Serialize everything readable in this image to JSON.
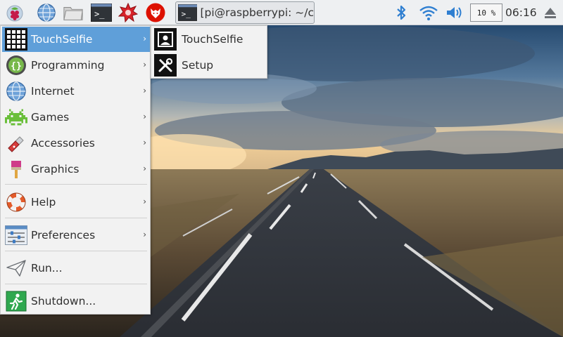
{
  "panel": {
    "launchers": [
      {
        "name": "raspberry-menu-icon"
      },
      {
        "name": "web-browser-icon"
      },
      {
        "name": "file-manager-icon"
      },
      {
        "name": "terminal-icon"
      },
      {
        "name": "mathematica-icon"
      },
      {
        "name": "wolfram-icon"
      }
    ],
    "task": {
      "label": "[pi@raspberrypi: ~/c..."
    },
    "tray": {
      "bluetooth_icon": "bluetooth-icon",
      "wifi_icon": "wifi-icon",
      "volume_icon": "volume-icon",
      "cpu_usage": "10 %",
      "clock": "06:16",
      "eject_icon": "eject-icon"
    }
  },
  "menu": {
    "items": [
      {
        "label": "TouchSelfie",
        "icon": "touchselfie-grid-icon",
        "submenu": true,
        "active": true
      },
      {
        "label": "Programming",
        "icon": "programming-braces-icon",
        "submenu": true
      },
      {
        "label": "Internet",
        "icon": "internet-globe-icon",
        "submenu": true
      },
      {
        "label": "Games",
        "icon": "games-invader-icon",
        "submenu": true
      },
      {
        "label": "Accessories",
        "icon": "accessories-knife-icon",
        "submenu": true
      },
      {
        "label": "Graphics",
        "icon": "graphics-brush-icon",
        "submenu": true
      },
      {
        "label": "Help",
        "icon": "help-lifebuoy-icon",
        "submenu": true
      },
      {
        "label": "Preferences",
        "icon": "preferences-sliders-icon",
        "submenu": true
      },
      {
        "label": "Run...",
        "icon": "run-paperplane-icon",
        "submenu": false
      },
      {
        "label": "Shutdown...",
        "icon": "shutdown-exit-icon",
        "submenu": false
      }
    ],
    "submenu_arrow": "›"
  },
  "submenu": {
    "items": [
      {
        "label": "TouchSelfie",
        "icon": "portrait-icon"
      },
      {
        "label": "Setup",
        "icon": "tools-icon"
      }
    ]
  },
  "colors": {
    "panel_bg": "#eef0f2",
    "menu_bg": "#f2f2f2",
    "menu_highlight": "#5f9fd9"
  }
}
